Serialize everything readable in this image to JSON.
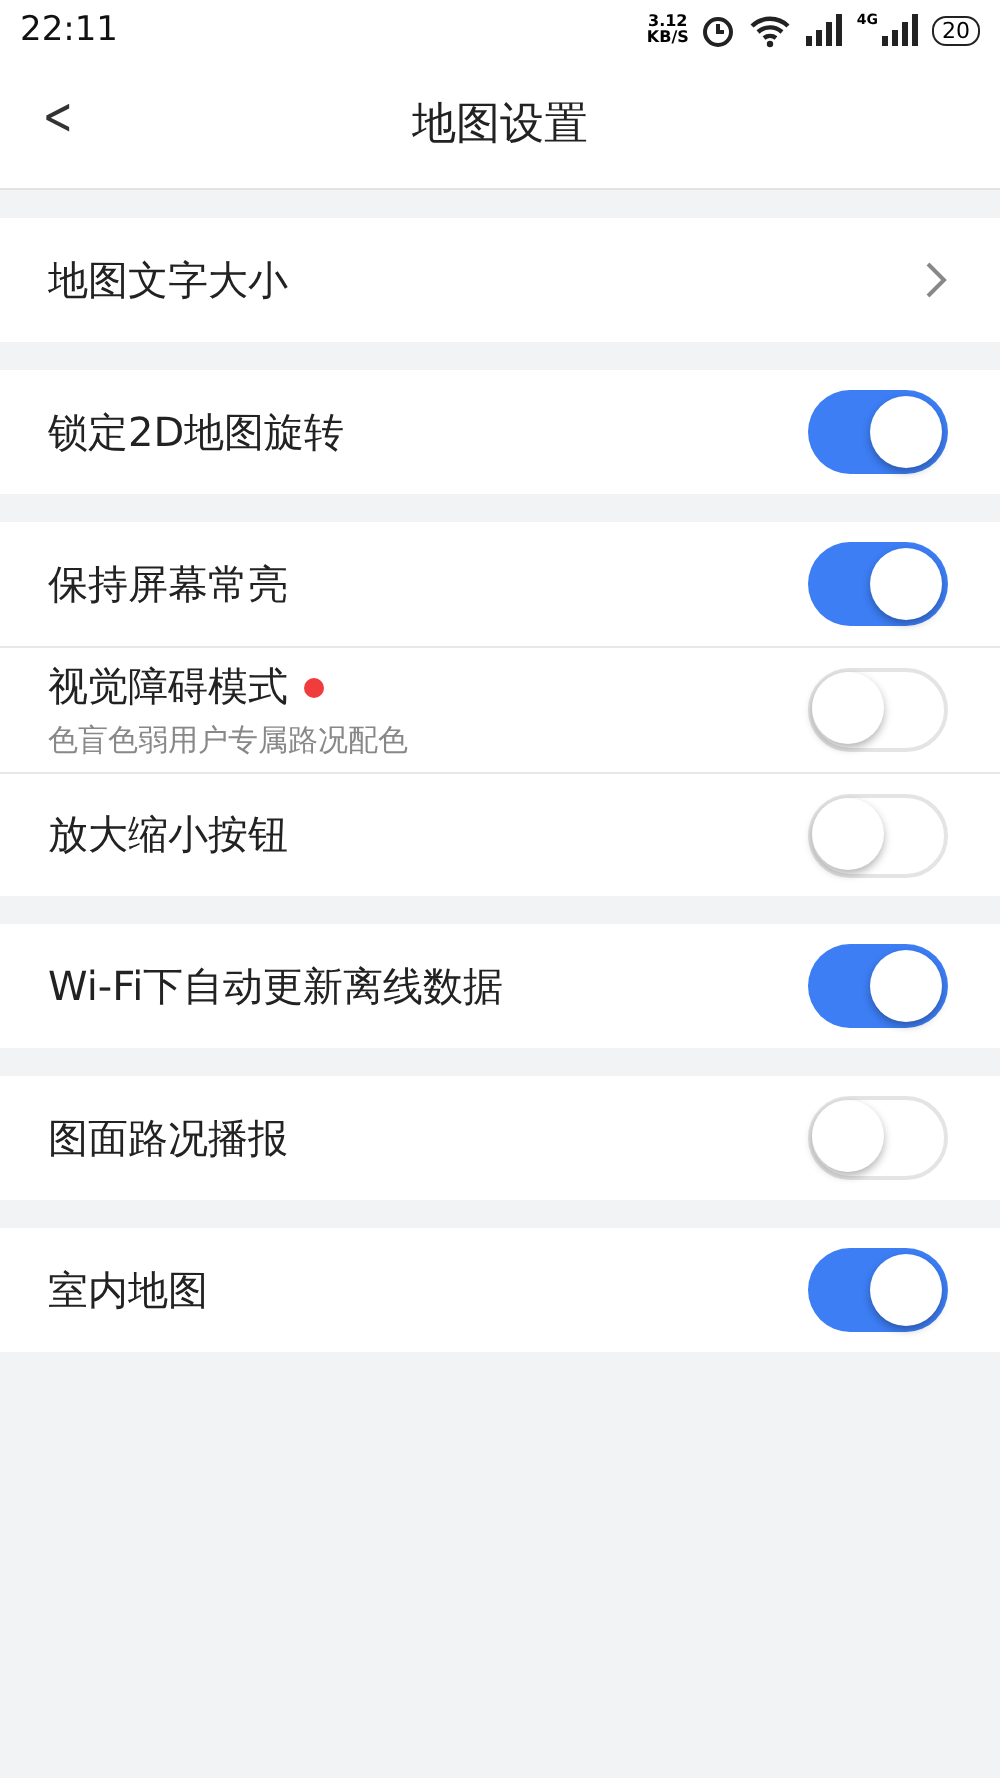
{
  "status_bar": {
    "time": "22:11",
    "speed_value": "3.12",
    "speed_unit": "KB/S",
    "network": "4G",
    "battery": "20"
  },
  "header": {
    "back": "<",
    "title": "地图设置"
  },
  "groups": [
    {
      "items": [
        {
          "kind": "link",
          "label": "地图文字大小"
        }
      ]
    },
    {
      "items": [
        {
          "kind": "toggle",
          "label": "锁定2D地图旋转",
          "on": true
        }
      ]
    },
    {
      "items": [
        {
          "kind": "toggle",
          "label": "保持屏幕常亮",
          "on": true
        },
        {
          "kind": "toggle",
          "label": "视觉障碍模式",
          "new_dot": true,
          "subtitle": "色盲色弱用户专属路况配色",
          "on": false
        },
        {
          "kind": "toggle",
          "label": "放大缩小按钮",
          "on": false
        }
      ]
    },
    {
      "items": [
        {
          "kind": "toggle",
          "label": "Wi-Fi下自动更新离线数据",
          "on": true
        }
      ]
    },
    {
      "items": [
        {
          "kind": "toggle",
          "label": "图面路况播报",
          "on": false
        }
      ]
    },
    {
      "items": [
        {
          "kind": "toggle",
          "label": "室内地图",
          "on": true
        }
      ]
    }
  ]
}
